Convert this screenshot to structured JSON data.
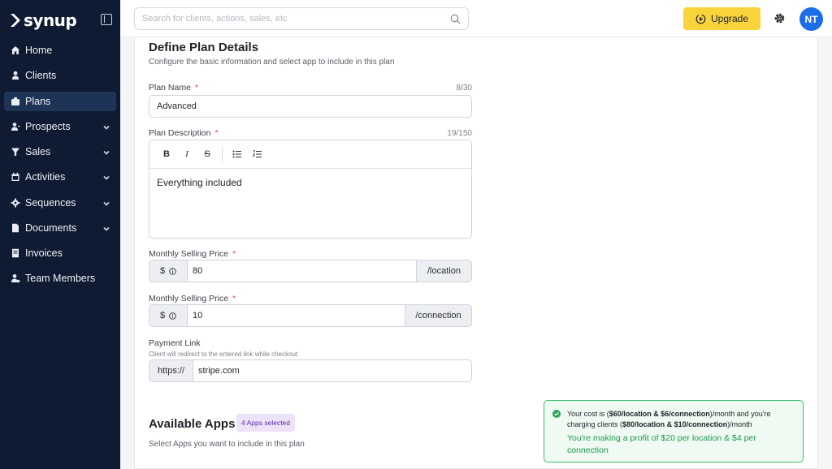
{
  "brand": {
    "name": "synup"
  },
  "sidebar": {
    "items": [
      {
        "label": "Home",
        "icon": "home-icon",
        "active": false,
        "expandable": false
      },
      {
        "label": "Clients",
        "icon": "person-icon",
        "active": false,
        "expandable": false
      },
      {
        "label": "Plans",
        "icon": "plans-icon",
        "active": true,
        "expandable": false
      },
      {
        "label": "Prospects",
        "icon": "prospects-icon",
        "active": false,
        "expandable": true
      },
      {
        "label": "Sales",
        "icon": "funnel-icon",
        "active": false,
        "expandable": true
      },
      {
        "label": "Activities",
        "icon": "calendar-icon",
        "active": false,
        "expandable": true
      },
      {
        "label": "Sequences",
        "icon": "cog-icon",
        "active": false,
        "expandable": true
      },
      {
        "label": "Documents",
        "icon": "document-icon",
        "active": false,
        "expandable": true
      },
      {
        "label": "Invoices",
        "icon": "invoice-icon",
        "active": false,
        "expandable": false
      },
      {
        "label": "Team Members",
        "icon": "team-icon",
        "active": false,
        "expandable": false
      }
    ]
  },
  "header": {
    "search_placeholder": "Search for clients, actions, sales, etc",
    "upgrade_label": "Upgrade",
    "avatar_initials": "NT"
  },
  "form": {
    "title": "Define Plan Details",
    "subtitle": "Configure the basic information and select app to include in this plan",
    "plan_name": {
      "label": "Plan Name",
      "required_mark": "*",
      "counter": "8/30",
      "value": "Advanced"
    },
    "plan_description": {
      "label": "Plan Description",
      "required_mark": "*",
      "counter": "19/150",
      "value": "Everything included",
      "toolbar": {
        "bold": "B",
        "italic": "I",
        "strike": "S"
      }
    },
    "price_location": {
      "label": "Monthly Selling Price",
      "required_mark": "*",
      "currency": "$",
      "value": "80",
      "unit": "/location"
    },
    "price_connection": {
      "label": "Monthly Selling Price",
      "required_mark": "*",
      "currency": "$",
      "value": "10",
      "unit": "/connection"
    },
    "payment_link": {
      "label": "Payment Link",
      "hint": "Client will redirect to the entered link while checkout",
      "prefix": "https://",
      "value": "stripe.com"
    }
  },
  "apps": {
    "title": "Available Apps",
    "badge": "4 Apps selected",
    "subtitle": "Select Apps you want to include in this plan"
  },
  "notice": {
    "cost_prefix": "Your cost is (",
    "cost_value": "$60/location & $6/connection",
    "cost_mid": ")/month and you're charging clients (",
    "charge_value": "$80/location & $10/connection",
    "cost_suffix": ")/month",
    "profit": "You're making a profit of $20 per location & $4 per connection"
  },
  "colors": {
    "sidebar_bg": "#0f1b33",
    "active_item": "#1d3457",
    "upgrade_bg": "#f8d33b",
    "avatar_bg": "#1a6ee8",
    "required": "#e5484d",
    "success": "#1e9a4a",
    "badge_bg": "#ece3fb"
  }
}
